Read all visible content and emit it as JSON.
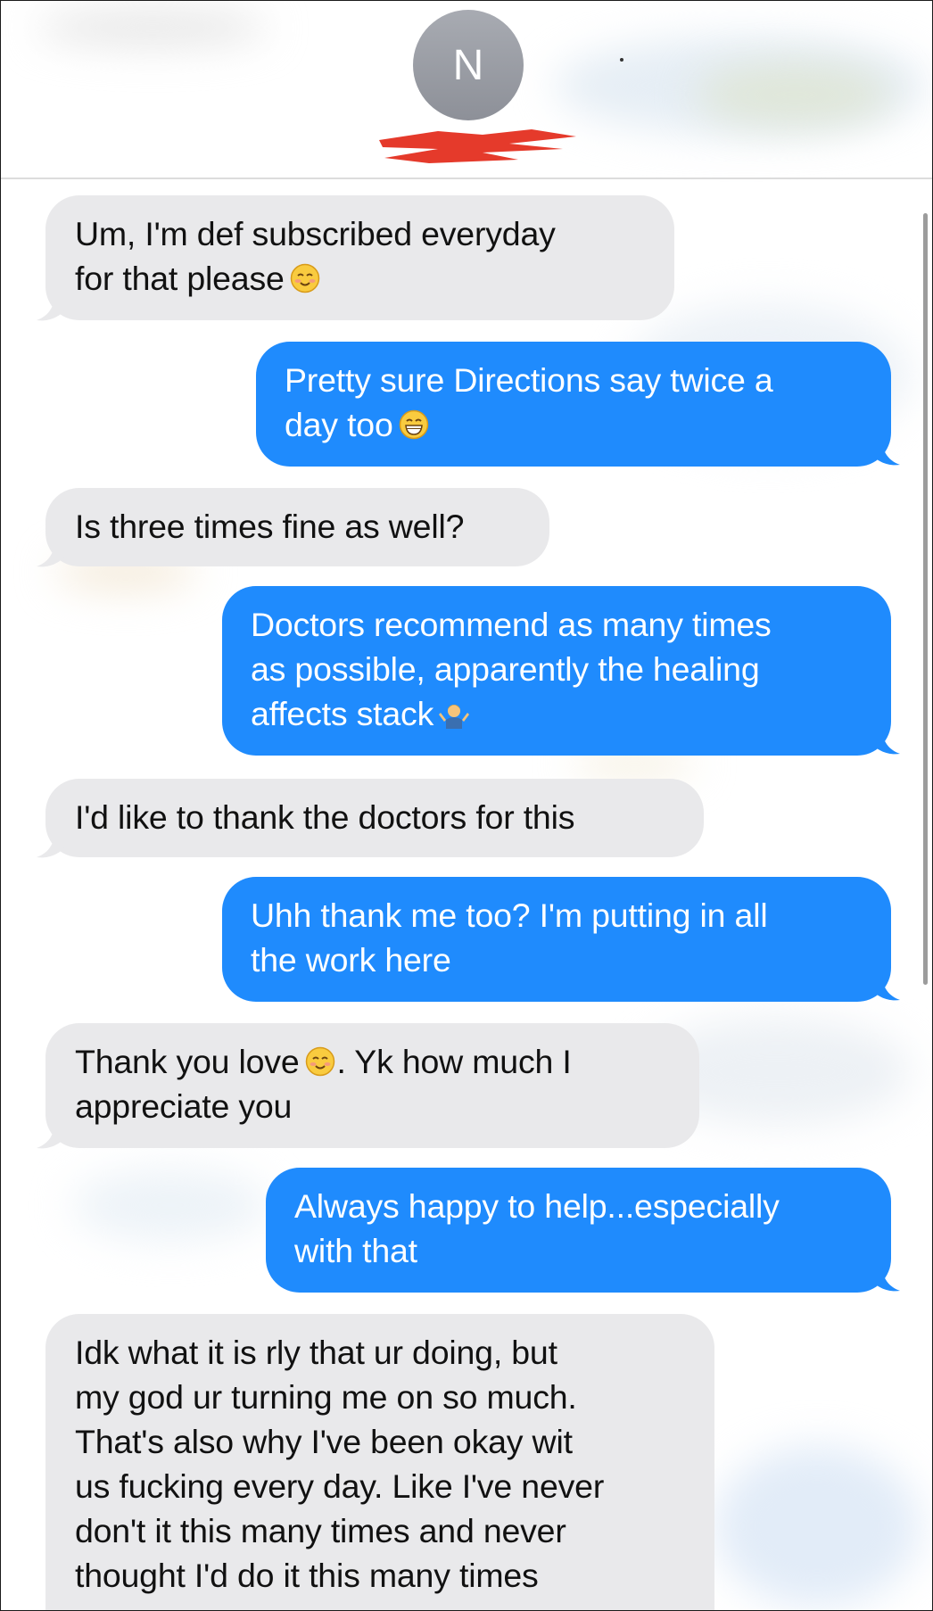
{
  "header": {
    "contact_initial": "N"
  },
  "messages": [
    {
      "from": "them",
      "text": "Um, I'm def subscribed everyday\nfor that please",
      "emoji": "smiling-blush-icon"
    },
    {
      "from": "me",
      "text": "Pretty sure Directions say twice a\nday too",
      "emoji": "grinning-face-icon"
    },
    {
      "from": "them",
      "text": "Is three times fine as well?"
    },
    {
      "from": "me",
      "text": "Doctors recommend as many times\nas possible, apparently the healing\naffects stack",
      "emoji": "person-shrugging-icon"
    },
    {
      "from": "them",
      "text": "I'd like to thank the doctors for this"
    },
    {
      "from": "me",
      "text": "Uhh thank me too? I'm putting in all\nthe work here"
    },
    {
      "from": "them",
      "text_before": "Thank you love",
      "text_after": ". Yk how much I\nappreciate you",
      "emoji": "smiling-blush-icon"
    },
    {
      "from": "me",
      "text": "Always happy to help...especially\nwith that"
    },
    {
      "from": "them",
      "text": "Idk what it is rly that ur doing, but\nmy god ur turning me on so much.\nThat's also why I've been okay wit\nus fucking every day. Like I've never\ndon't it this many times and never\nthought I'd do it this many times"
    }
  ],
  "colors": {
    "sent_bubble": "#1f8bfd",
    "received_bubble": "#e9e9eb",
    "redaction": "#e53a2b"
  }
}
